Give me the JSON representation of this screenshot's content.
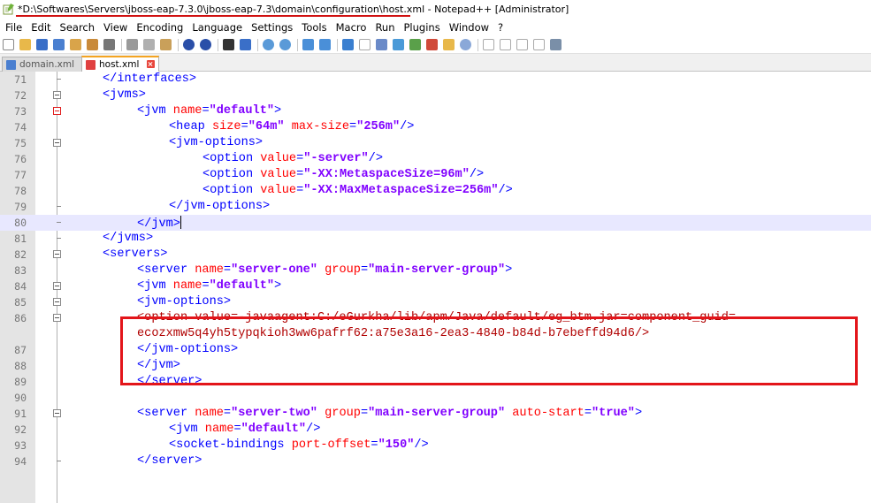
{
  "window": {
    "title": "*D:\\Softwares\\Servers\\jboss-eap-7.3.0\\jboss-eap-7.3\\domain\\configuration\\host.xml - Notepad++ [Administrator]"
  },
  "menu": {
    "items": [
      "File",
      "Edit",
      "Search",
      "View",
      "Encoding",
      "Language",
      "Settings",
      "Tools",
      "Macro",
      "Run",
      "Plugins",
      "Window",
      "?"
    ]
  },
  "tabs": [
    {
      "label": "domain.xml",
      "active": false
    },
    {
      "label": "host.xml",
      "active": true
    }
  ],
  "editor": {
    "lines": [
      {
        "num": "71",
        "fold": "line",
        "text": "</interfaces>"
      },
      {
        "num": "72",
        "fold": "box",
        "text": "<jvms>"
      },
      {
        "num": "73",
        "fold": "box-red",
        "text": "<jvm name=\"default\">"
      },
      {
        "num": "74",
        "fold": "line",
        "text": "<heap size=\"64m\" max-size=\"256m\"/>"
      },
      {
        "num": "75",
        "fold": "box",
        "text": "<jvm-options>"
      },
      {
        "num": "76",
        "fold": "line",
        "text": "<option value=\"-server\"/>"
      },
      {
        "num": "77",
        "fold": "line",
        "text": "<option value=\"-XX:MetaspaceSize=96m\"/>"
      },
      {
        "num": "78",
        "fold": "line",
        "text": "<option value=\"-XX:MaxMetaspaceSize=256m\"/>"
      },
      {
        "num": "79",
        "fold": "end",
        "text": "</jvm-options>"
      },
      {
        "num": "80",
        "fold": "end",
        "text": "</jvm>"
      },
      {
        "num": "81",
        "fold": "end",
        "text": "</jvms>"
      },
      {
        "num": "82",
        "fold": "box",
        "text": "<servers>"
      },
      {
        "num": "83",
        "fold": "line",
        "text": "<server name=\"server-one\" group=\"main-server-group\">"
      },
      {
        "num": "84",
        "fold": "box",
        "text": "<jvm name=\"default\">"
      },
      {
        "num": "85",
        "fold": "box",
        "text": "<jvm-options>"
      },
      {
        "num": "86",
        "fold": "box",
        "text": "<option value=-javaagent:C:/eGurkha/lib/apm/Java/default/eg_btm.jar=component_guid="
      },
      {
        "num": "",
        "fold": "line",
        "text": "ecozxmw5q4yh5typqkioh3ww6pafrf62:a75e3a16-2ea3-4840-b84d-b7ebeffd94d6/>"
      },
      {
        "num": "87",
        "fold": "line",
        "text": "</jvm-options>"
      },
      {
        "num": "88",
        "fold": "line",
        "text": "</jvm>"
      },
      {
        "num": "89",
        "fold": "line",
        "text": "</server>"
      },
      {
        "num": "90",
        "fold": "line",
        "text": ""
      },
      {
        "num": "91",
        "fold": "box",
        "text": "<server name=\"server-two\" group=\"main-server-group\" auto-start=\"true\">"
      },
      {
        "num": "92",
        "fold": "line",
        "text": "<jvm name=\"default\"/>"
      },
      {
        "num": "93",
        "fold": "line",
        "text": "<socket-bindings port-offset=\"150\"/>"
      },
      {
        "num": "94",
        "fold": "end",
        "text": "</server>"
      }
    ]
  }
}
